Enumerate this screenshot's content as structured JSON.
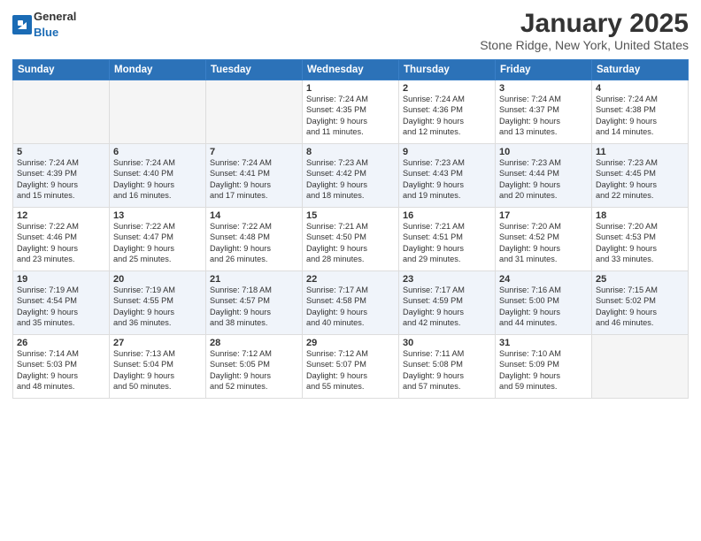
{
  "logo": {
    "general": "General",
    "blue": "Blue"
  },
  "title": "January 2025",
  "location": "Stone Ridge, New York, United States",
  "days_of_week": [
    "Sunday",
    "Monday",
    "Tuesday",
    "Wednesday",
    "Thursday",
    "Friday",
    "Saturday"
  ],
  "weeks": [
    [
      {
        "day": "",
        "info": ""
      },
      {
        "day": "",
        "info": ""
      },
      {
        "day": "",
        "info": ""
      },
      {
        "day": "1",
        "info": "Sunrise: 7:24 AM\nSunset: 4:35 PM\nDaylight: 9 hours\nand 11 minutes."
      },
      {
        "day": "2",
        "info": "Sunrise: 7:24 AM\nSunset: 4:36 PM\nDaylight: 9 hours\nand 12 minutes."
      },
      {
        "day": "3",
        "info": "Sunrise: 7:24 AM\nSunset: 4:37 PM\nDaylight: 9 hours\nand 13 minutes."
      },
      {
        "day": "4",
        "info": "Sunrise: 7:24 AM\nSunset: 4:38 PM\nDaylight: 9 hours\nand 14 minutes."
      }
    ],
    [
      {
        "day": "5",
        "info": "Sunrise: 7:24 AM\nSunset: 4:39 PM\nDaylight: 9 hours\nand 15 minutes."
      },
      {
        "day": "6",
        "info": "Sunrise: 7:24 AM\nSunset: 4:40 PM\nDaylight: 9 hours\nand 16 minutes."
      },
      {
        "day": "7",
        "info": "Sunrise: 7:24 AM\nSunset: 4:41 PM\nDaylight: 9 hours\nand 17 minutes."
      },
      {
        "day": "8",
        "info": "Sunrise: 7:23 AM\nSunset: 4:42 PM\nDaylight: 9 hours\nand 18 minutes."
      },
      {
        "day": "9",
        "info": "Sunrise: 7:23 AM\nSunset: 4:43 PM\nDaylight: 9 hours\nand 19 minutes."
      },
      {
        "day": "10",
        "info": "Sunrise: 7:23 AM\nSunset: 4:44 PM\nDaylight: 9 hours\nand 20 minutes."
      },
      {
        "day": "11",
        "info": "Sunrise: 7:23 AM\nSunset: 4:45 PM\nDaylight: 9 hours\nand 22 minutes."
      }
    ],
    [
      {
        "day": "12",
        "info": "Sunrise: 7:22 AM\nSunset: 4:46 PM\nDaylight: 9 hours\nand 23 minutes."
      },
      {
        "day": "13",
        "info": "Sunrise: 7:22 AM\nSunset: 4:47 PM\nDaylight: 9 hours\nand 25 minutes."
      },
      {
        "day": "14",
        "info": "Sunrise: 7:22 AM\nSunset: 4:48 PM\nDaylight: 9 hours\nand 26 minutes."
      },
      {
        "day": "15",
        "info": "Sunrise: 7:21 AM\nSunset: 4:50 PM\nDaylight: 9 hours\nand 28 minutes."
      },
      {
        "day": "16",
        "info": "Sunrise: 7:21 AM\nSunset: 4:51 PM\nDaylight: 9 hours\nand 29 minutes."
      },
      {
        "day": "17",
        "info": "Sunrise: 7:20 AM\nSunset: 4:52 PM\nDaylight: 9 hours\nand 31 minutes."
      },
      {
        "day": "18",
        "info": "Sunrise: 7:20 AM\nSunset: 4:53 PM\nDaylight: 9 hours\nand 33 minutes."
      }
    ],
    [
      {
        "day": "19",
        "info": "Sunrise: 7:19 AM\nSunset: 4:54 PM\nDaylight: 9 hours\nand 35 minutes."
      },
      {
        "day": "20",
        "info": "Sunrise: 7:19 AM\nSunset: 4:55 PM\nDaylight: 9 hours\nand 36 minutes."
      },
      {
        "day": "21",
        "info": "Sunrise: 7:18 AM\nSunset: 4:57 PM\nDaylight: 9 hours\nand 38 minutes."
      },
      {
        "day": "22",
        "info": "Sunrise: 7:17 AM\nSunset: 4:58 PM\nDaylight: 9 hours\nand 40 minutes."
      },
      {
        "day": "23",
        "info": "Sunrise: 7:17 AM\nSunset: 4:59 PM\nDaylight: 9 hours\nand 42 minutes."
      },
      {
        "day": "24",
        "info": "Sunrise: 7:16 AM\nSunset: 5:00 PM\nDaylight: 9 hours\nand 44 minutes."
      },
      {
        "day": "25",
        "info": "Sunrise: 7:15 AM\nSunset: 5:02 PM\nDaylight: 9 hours\nand 46 minutes."
      }
    ],
    [
      {
        "day": "26",
        "info": "Sunrise: 7:14 AM\nSunset: 5:03 PM\nDaylight: 9 hours\nand 48 minutes."
      },
      {
        "day": "27",
        "info": "Sunrise: 7:13 AM\nSunset: 5:04 PM\nDaylight: 9 hours\nand 50 minutes."
      },
      {
        "day": "28",
        "info": "Sunrise: 7:12 AM\nSunset: 5:05 PM\nDaylight: 9 hours\nand 52 minutes."
      },
      {
        "day": "29",
        "info": "Sunrise: 7:12 AM\nSunset: 5:07 PM\nDaylight: 9 hours\nand 55 minutes."
      },
      {
        "day": "30",
        "info": "Sunrise: 7:11 AM\nSunset: 5:08 PM\nDaylight: 9 hours\nand 57 minutes."
      },
      {
        "day": "31",
        "info": "Sunrise: 7:10 AM\nSunset: 5:09 PM\nDaylight: 9 hours\nand 59 minutes."
      },
      {
        "day": "",
        "info": ""
      }
    ]
  ]
}
